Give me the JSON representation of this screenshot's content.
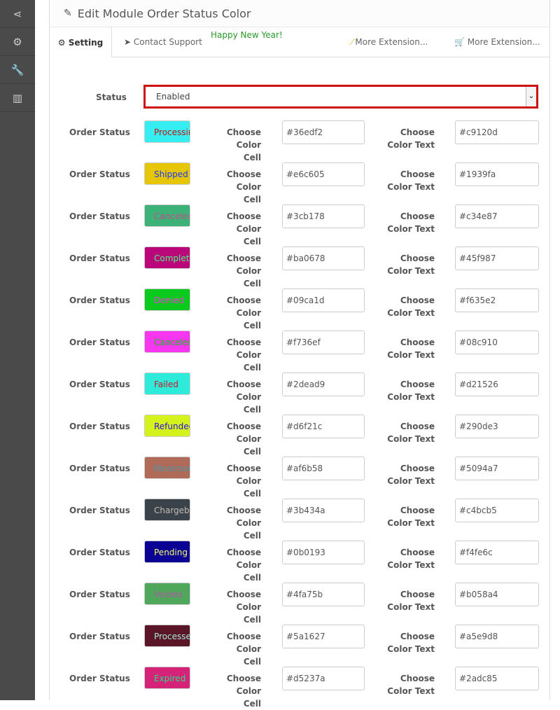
{
  "sidebar": {
    "items": [
      {
        "icon": "share-icon",
        "glyph": "⋖"
      },
      {
        "icon": "gear-icon",
        "glyph": "⚙"
      },
      {
        "icon": "wrench-icon",
        "glyph": "🔧"
      },
      {
        "icon": "bar-chart-icon",
        "glyph": "▥"
      }
    ]
  },
  "header": {
    "title": "Edit Module Order Status Color"
  },
  "tabs": {
    "setting": "Setting",
    "contact": "Contact Support",
    "greeting": "Happy New Year!",
    "more1": "More Extension...",
    "more2": "More Extension..."
  },
  "status": {
    "label": "Status",
    "value": "Enabled"
  },
  "labels": {
    "order_status": "Order Status",
    "choose": "Choose",
    "color_cell": "Color Cell",
    "color_text": "Color Text"
  },
  "rows": [
    {
      "name": "Processing",
      "cell": "#36edf2",
      "text": "#c9120d"
    },
    {
      "name": "Shipped",
      "cell": "#e6c605",
      "text": "#1939fa"
    },
    {
      "name": "Canceled",
      "cell": "#3cb178",
      "text": "#c34e87"
    },
    {
      "name": "Complete",
      "cell": "#ba0678",
      "text": "#45f987"
    },
    {
      "name": "Denied",
      "cell": "#09ca1d",
      "text": "#f635e2"
    },
    {
      "name": "Canceled Reversal",
      "cell": "#f736ef",
      "text": "#08c910"
    },
    {
      "name": "Failed",
      "cell": "#2dead9",
      "text": "#d21526"
    },
    {
      "name": "Refunded",
      "cell": "#d6f21c",
      "text": "#290de3"
    },
    {
      "name": "Reversed",
      "cell": "#af6b58",
      "text": "#5094a7"
    },
    {
      "name": "Chargeback",
      "cell": "#3b434a",
      "text": "#c4bcb5"
    },
    {
      "name": "Pending",
      "cell": "#0b0193",
      "text": "#f4fe6c"
    },
    {
      "name": "Voided",
      "cell": "#4fa75b",
      "text": "#b058a4"
    },
    {
      "name": "Processed",
      "cell": "#5a1627",
      "text": "#a5e9d8"
    },
    {
      "name": "Expired",
      "cell": "#d5237a",
      "text": "#2adc85"
    }
  ]
}
